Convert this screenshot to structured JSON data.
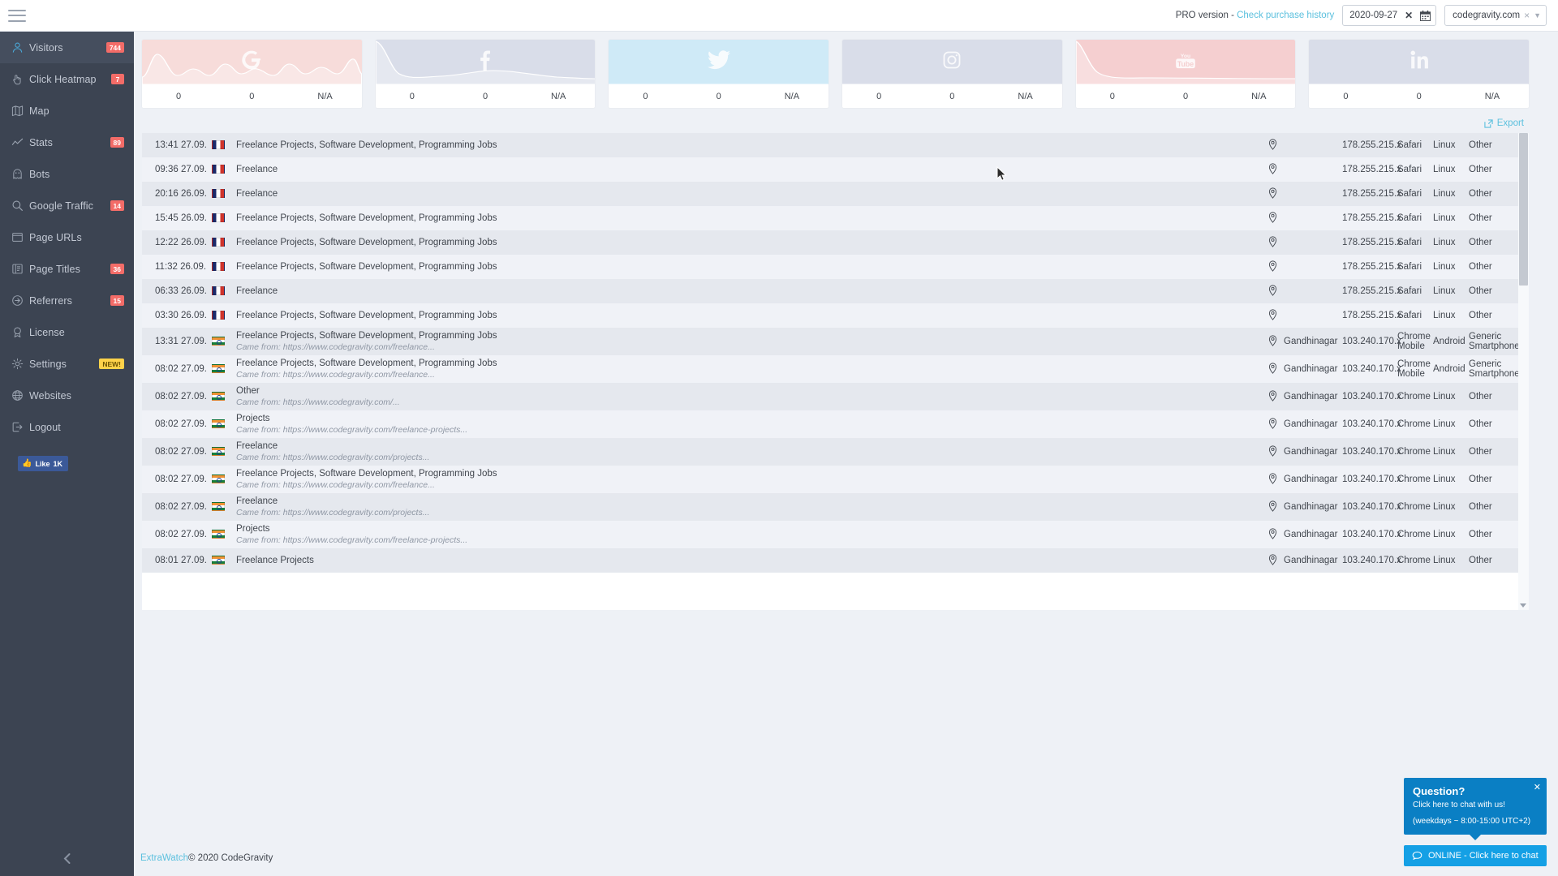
{
  "sidebar": {
    "items": [
      {
        "label": "Visitors",
        "icon": "user-icon",
        "badge": "744",
        "active": true
      },
      {
        "label": "Click Heatmap",
        "icon": "hand-click-icon",
        "badge": "7",
        "active": false
      },
      {
        "label": "Map",
        "icon": "map-icon",
        "badge": "",
        "active": false
      },
      {
        "label": "Stats",
        "icon": "chart-line-icon",
        "badge": "89",
        "active": false
      },
      {
        "label": "Bots",
        "icon": "ghost-icon",
        "badge": "",
        "active": false
      },
      {
        "label": "Google Traffic",
        "icon": "search-icon",
        "badge": "14",
        "active": false
      },
      {
        "label": "Page URLs",
        "icon": "window-icon",
        "badge": "",
        "active": false
      },
      {
        "label": "Page Titles",
        "icon": "book-icon",
        "badge": "36",
        "active": false
      },
      {
        "label": "Referrers",
        "icon": "arrow-circle-icon",
        "badge": "15",
        "active": false
      },
      {
        "label": "License",
        "icon": "award-icon",
        "badge": "",
        "active": false
      },
      {
        "label": "Settings",
        "icon": "gear-icon",
        "badge": "NEW!",
        "active": false,
        "badge_type": "new"
      },
      {
        "label": "Websites",
        "icon": "globe-icon",
        "badge": "",
        "active": false
      },
      {
        "label": "Logout",
        "icon": "logout-icon",
        "badge": "",
        "active": false
      }
    ],
    "like_button": {
      "label": "Like",
      "count": "1K"
    },
    "collapse_icon": "chevron-left-icon"
  },
  "topbar": {
    "pro_label": "PRO version - ",
    "purchase_link": "Check purchase history",
    "date_value": "2020-09-27",
    "date_clear_icon": "close-icon",
    "calendar_icon": "calendar-icon",
    "site_value": "codegravity.com",
    "site_clear_icon": "close-icon",
    "site_caret_icon": "chevron-down-icon"
  },
  "social_cards": [
    {
      "name": "google",
      "logo": "G",
      "bg": "#f7dcda",
      "line": "#ffffff",
      "stats": [
        "0",
        "0",
        "N/A"
      ]
    },
    {
      "name": "facebook",
      "logo": "f",
      "bg": "#d9dde9",
      "line": "#ffffff",
      "stats": [
        "0",
        "0",
        "N/A"
      ]
    },
    {
      "name": "twitter",
      "logo": "twitter",
      "bg": "#cfeaf7",
      "line": "#ffffff",
      "stats": [
        "0",
        "0",
        "N/A"
      ]
    },
    {
      "name": "instagram",
      "logo": "instagram",
      "bg": "#d9dde9",
      "line": "#ffffff",
      "stats": [
        "0",
        "0",
        "N/A"
      ]
    },
    {
      "name": "youtube",
      "logo": "youtube",
      "bg": "#f5cfd0",
      "line": "#ffffff",
      "stats": [
        "0",
        "0",
        "N/A"
      ]
    },
    {
      "name": "linkedin",
      "logo": "in",
      "bg": "#d9dde9",
      "line": "#ffffff",
      "stats": [
        "0",
        "0",
        "N/A"
      ]
    }
  ],
  "export": {
    "label": "Export",
    "icon": "external-link-icon"
  },
  "visitors_table": {
    "rows": [
      {
        "time": "13:41 27.09.",
        "flag": "fr",
        "title": "Freelance Projects, Software Development, Programming Jobs",
        "sub": "",
        "city": "",
        "ip": "178.255.215.x",
        "browser": "Safari",
        "os": "Linux",
        "device": "Other"
      },
      {
        "time": "09:36 27.09.",
        "flag": "fr",
        "title": "Freelance",
        "sub": "",
        "city": "",
        "ip": "178.255.215.x",
        "browser": "Safari",
        "os": "Linux",
        "device": "Other"
      },
      {
        "time": "20:16 26.09.",
        "flag": "fr",
        "title": "Freelance",
        "sub": "",
        "city": "",
        "ip": "178.255.215.x",
        "browser": "Safari",
        "os": "Linux",
        "device": "Other"
      },
      {
        "time": "15:45 26.09.",
        "flag": "fr",
        "title": "Freelance Projects, Software Development, Programming Jobs",
        "sub": "",
        "city": "",
        "ip": "178.255.215.x",
        "browser": "Safari",
        "os": "Linux",
        "device": "Other"
      },
      {
        "time": "12:22 26.09.",
        "flag": "fr",
        "title": "Freelance Projects, Software Development, Programming Jobs",
        "sub": "",
        "city": "",
        "ip": "178.255.215.x",
        "browser": "Safari",
        "os": "Linux",
        "device": "Other"
      },
      {
        "time": "11:32 26.09.",
        "flag": "fr",
        "title": "Freelance Projects, Software Development, Programming Jobs",
        "sub": "",
        "city": "",
        "ip": "178.255.215.x",
        "browser": "Safari",
        "os": "Linux",
        "device": "Other"
      },
      {
        "time": "06:33 26.09.",
        "flag": "fr",
        "title": "Freelance",
        "sub": "",
        "city": "",
        "ip": "178.255.215.x",
        "browser": "Safari",
        "os": "Linux",
        "device": "Other"
      },
      {
        "time": "03:30 26.09.",
        "flag": "fr",
        "title": "Freelance Projects, Software Development, Programming Jobs",
        "sub": "",
        "city": "",
        "ip": "178.255.215.x",
        "browser": "Safari",
        "os": "Linux",
        "device": "Other"
      },
      {
        "time": "13:31 27.09.",
        "flag": "in",
        "title": "Freelance Projects, Software Development, Programming Jobs",
        "sub": "Came from: https://www.codegravity.com/freelance...",
        "city": "Gandhinagar",
        "ip": "103.240.170.x",
        "browser": "Chrome Mobile",
        "os": "Android",
        "device": "Generic Smartphone"
      },
      {
        "time": "08:02 27.09.",
        "flag": "in",
        "title": "Freelance Projects, Software Development, Programming Jobs",
        "sub": "Came from: https://www.codegravity.com/freelance...",
        "city": "Gandhinagar",
        "ip": "103.240.170.x",
        "browser": "Chrome Mobile",
        "os": "Android",
        "device": "Generic Smartphone"
      },
      {
        "time": "08:02 27.09.",
        "flag": "in",
        "title": "Other",
        "sub": "Came from: https://www.codegravity.com/...",
        "city": "Gandhinagar",
        "ip": "103.240.170.x",
        "browser": "Chrome",
        "os": "Linux",
        "device": "Other"
      },
      {
        "time": "08:02 27.09.",
        "flag": "in",
        "title": "Projects",
        "sub": "Came from: https://www.codegravity.com/freelance-projects...",
        "city": "Gandhinagar",
        "ip": "103.240.170.x",
        "browser": "Chrome",
        "os": "Linux",
        "device": "Other"
      },
      {
        "time": "08:02 27.09.",
        "flag": "in",
        "title": "Freelance",
        "sub": "Came from: https://www.codegravity.com/projects...",
        "city": "Gandhinagar",
        "ip": "103.240.170.x",
        "browser": "Chrome",
        "os": "Linux",
        "device": "Other"
      },
      {
        "time": "08:02 27.09.",
        "flag": "in",
        "title": "Freelance Projects, Software Development, Programming Jobs",
        "sub": "Came from: https://www.codegravity.com/freelance...",
        "city": "Gandhinagar",
        "ip": "103.240.170.x",
        "browser": "Chrome",
        "os": "Linux",
        "device": "Other"
      },
      {
        "time": "08:02 27.09.",
        "flag": "in",
        "title": "Freelance",
        "sub": "Came from: https://www.codegravity.com/projects...",
        "city": "Gandhinagar",
        "ip": "103.240.170.x",
        "browser": "Chrome",
        "os": "Linux",
        "device": "Other"
      },
      {
        "time": "08:02 27.09.",
        "flag": "in",
        "title": "Projects",
        "sub": "Came from: https://www.codegravity.com/freelance-projects...",
        "city": "Gandhinagar",
        "ip": "103.240.170.x",
        "browser": "Chrome",
        "os": "Linux",
        "device": "Other"
      },
      {
        "time": "08:01 27.09.",
        "flag": "in",
        "title": "Freelance Projects",
        "sub": "",
        "city": "Gandhinagar",
        "ip": "103.240.170.x",
        "browser": "Chrome",
        "os": "Linux",
        "device": "Other"
      }
    ]
  },
  "footer": {
    "brand": "ExtraWatch",
    "copyright": " © 2020 CodeGravity"
  },
  "chat": {
    "title": "Question?",
    "subtitle": "Click here to chat with us!",
    "hours": "(weekdays ~ 8:00-15:00 UTC+2)",
    "close_icon": "close-icon",
    "button_label": "ONLINE - Click here to chat",
    "button_icon": "chat-bubble-icon"
  }
}
